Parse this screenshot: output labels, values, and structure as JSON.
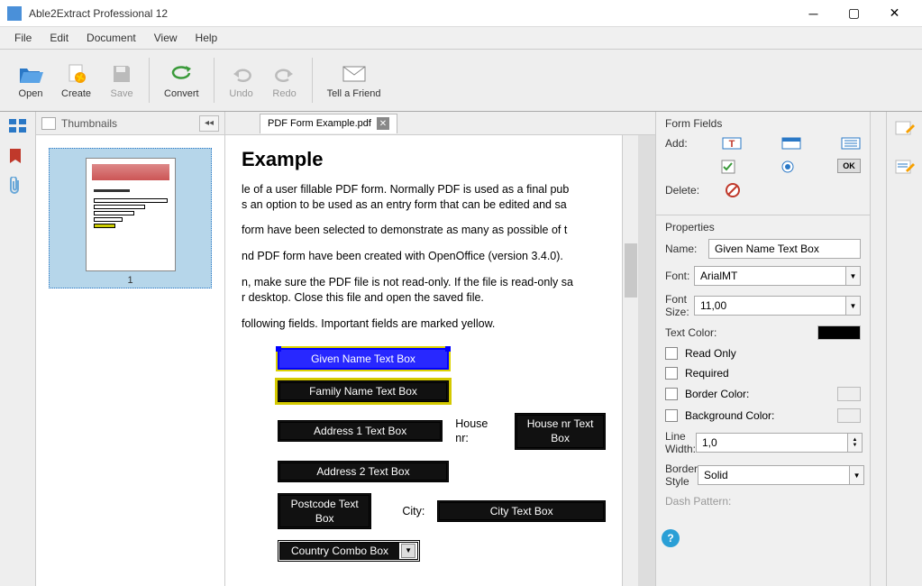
{
  "app": {
    "title": "Able2Extract Professional 12"
  },
  "menu": [
    "File",
    "Edit",
    "Document",
    "View",
    "Help"
  ],
  "toolbar": {
    "open": "Open",
    "create": "Create",
    "save": "Save",
    "convert": "Convert",
    "undo": "Undo",
    "redo": "Redo",
    "tell": "Tell a Friend"
  },
  "thumbnails": {
    "title": "Thumbnails",
    "page1": "1"
  },
  "tab": {
    "name": "PDF Form Example.pdf"
  },
  "doc": {
    "heading": "Example",
    "p1": "le of a user fillable PDF form. Normally PDF is used as a final pub",
    "p2": "s an option to be used as an entry form that can be edited and sa",
    "p3": "form have been selected to demonstrate as many as possible of t",
    "p4": "nd PDF form have been created with OpenOffice (version 3.4.0).",
    "p5": "n, make sure the PDF file is not read-only. If the file is read-only sa",
    "p6": "r desktop. Close this file and open the saved file.",
    "p7": " following fields. Important fields are marked yellow.",
    "f_given": "Given Name Text Box",
    "f_family": "Family Name Text Box",
    "f_addr1": "Address 1 Text Box",
    "f_addr2": "Address 2 Text Box",
    "house_lbl": "House nr:",
    "f_house": "House nr Text Box",
    "f_postcode": "Postcode Text Box",
    "city_lbl": "City:",
    "f_city": "City Text Box",
    "f_country": "Country Combo Box"
  },
  "panel": {
    "ff_head": "Form Fields",
    "add": "Add:",
    "delete": "Delete:",
    "ok": "OK",
    "props_head": "Properties",
    "name_lbl": "Name:",
    "name_val": "Given Name Text Box",
    "font_lbl": "Font:",
    "font_val": "ArialMT",
    "fontsize_lbl": "Font Size:",
    "fontsize_val": "11,00",
    "textcolor_lbl": "Text Color:",
    "readonly": "Read Only",
    "required": "Required",
    "bordercolor": "Border Color:",
    "bgcolor": "Background Color:",
    "linewidth_lbl": "Line Width:",
    "linewidth_val": "1,0",
    "borderstyle_lbl": "Border Style",
    "borderstyle_val": "Solid",
    "dash_lbl": "Dash Pattern:"
  }
}
